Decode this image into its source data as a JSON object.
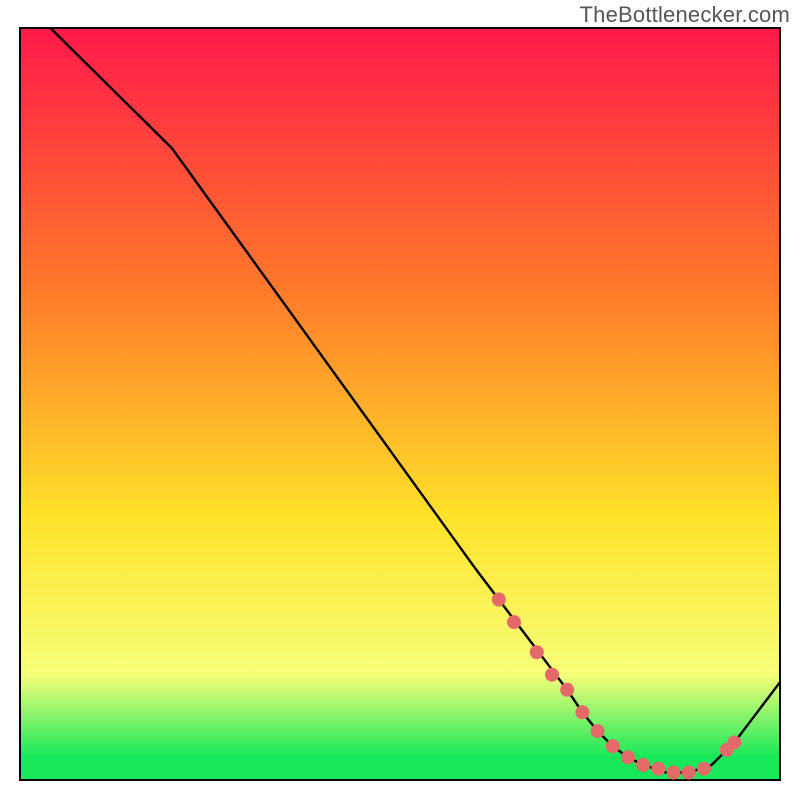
{
  "attribution": "TheBottlenecker.com",
  "chart_data": {
    "type": "line",
    "title": "",
    "xlabel": "",
    "ylabel": "",
    "xlim": [
      0,
      100
    ],
    "ylim": [
      0,
      100
    ],
    "grid": false,
    "legend": false,
    "line": {
      "name": "curve",
      "x": [
        4,
        7,
        10,
        13,
        16,
        20,
        25,
        30,
        35,
        40,
        45,
        50,
        55,
        60,
        63,
        66,
        69,
        72,
        74,
        76,
        78,
        80,
        82,
        85,
        88,
        91,
        94,
        97,
        100
      ],
      "y": [
        100,
        97,
        94,
        91,
        88,
        84,
        77,
        70,
        63,
        56,
        49,
        42,
        35,
        28,
        24,
        20,
        16,
        12,
        9,
        6.5,
        4.5,
        3,
        2,
        1,
        1,
        2,
        5,
        9,
        13
      ]
    },
    "marker_points": {
      "name": "dots",
      "x": [
        63,
        65,
        68,
        70,
        72,
        74,
        76,
        78,
        80,
        82,
        84,
        86,
        88,
        90,
        93,
        94
      ],
      "y": [
        24,
        21,
        17,
        14,
        12,
        9,
        6.5,
        4.5,
        3,
        2,
        1.5,
        1,
        1,
        1.5,
        4,
        5
      ]
    },
    "background_gradient": {
      "top": "#ff1a4a",
      "mid1": "#ff7a2a",
      "mid2": "#ffe22a",
      "band": "#f6ff7a",
      "green": "#17e85a"
    },
    "marker_color": "#e46a6a",
    "line_color": "#000000"
  }
}
